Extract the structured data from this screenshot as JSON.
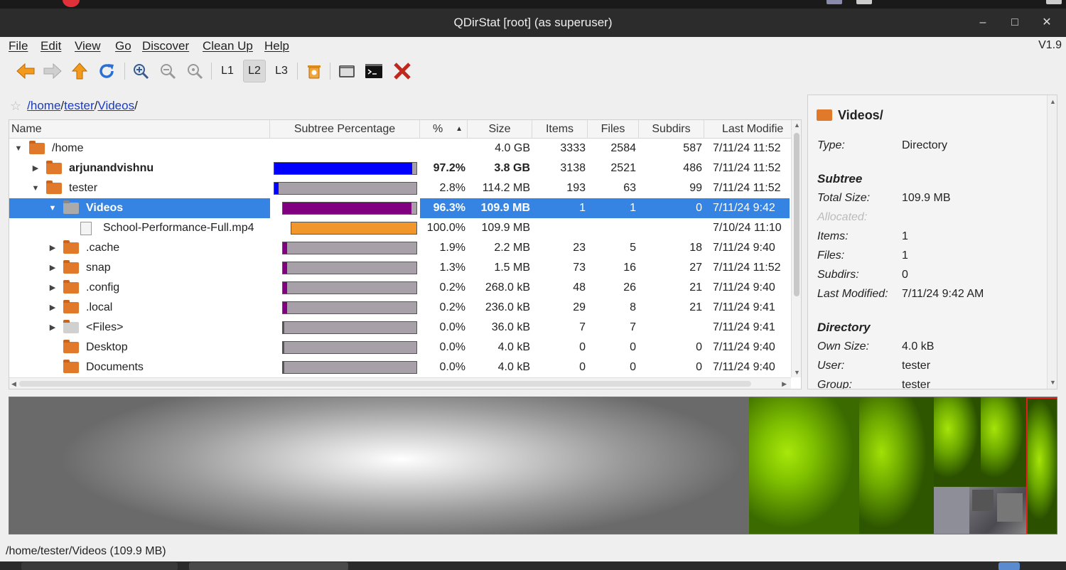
{
  "window": {
    "title": "QDirStat [root] (as superuser)",
    "version": "V1.9"
  },
  "menu": {
    "file": "File",
    "edit": "Edit",
    "view": "View",
    "go": "Go",
    "discover": "Discover",
    "cleanup": "Clean Up",
    "help": "Help"
  },
  "toolbar": {
    "l1": "L1",
    "l2": "L2",
    "l3": "L3"
  },
  "breadcrumb": {
    "sep0": "/",
    "p1": "home",
    "sep1": "/",
    "p2": "tester",
    "sep2": "/",
    "p3": "Videos",
    "sep3": "/"
  },
  "columns": {
    "name": "Name",
    "subtree": "Subtree Percentage",
    "pct": "%",
    "size": "Size",
    "items": "Items",
    "files": "Files",
    "subdirs": "Subdirs",
    "modified": "Last Modifie"
  },
  "rows": [
    {
      "name": "/home",
      "pct": "",
      "fill": 0,
      "fill_color": "",
      "size": "4.0 GB",
      "items": "3333",
      "files": "2584",
      "subdirs": "587",
      "modified": "7/11/24 11:52"
    },
    {
      "name": "arjunandvishnu",
      "pct": "97.2%",
      "fill": 0.972,
      "fill_color": "#0000ff",
      "size": "3.8 GB",
      "items": "3138",
      "files": "2521",
      "subdirs": "486",
      "modified": "7/11/24 11:52"
    },
    {
      "name": "tester",
      "pct": "2.8%",
      "fill": 0.028,
      "fill_color": "#0000ff",
      "size": "114.2 MB",
      "items": "193",
      "files": "63",
      "subdirs": "99",
      "modified": "7/11/24 11:52"
    },
    {
      "name": "Videos",
      "pct": "96.3%",
      "fill": 0.963,
      "fill_color": "#800080",
      "size": "109.9 MB",
      "items": "1",
      "files": "1",
      "subdirs": "0",
      "modified": "7/11/24 9:42 "
    },
    {
      "name": "School-Performance-Full.mp4",
      "pct": "100.0%",
      "fill": 1.0,
      "fill_color": "#f0962a",
      "size": "109.9 MB",
      "items": "",
      "files": "",
      "subdirs": "",
      "modified": "7/10/24 11:10"
    },
    {
      "name": ".cache",
      "pct": "1.9%",
      "fill": 0.019,
      "fill_color": "#800080",
      "size": "2.2 MB",
      "items": "23",
      "files": "5",
      "subdirs": "18",
      "modified": "7/11/24 9:40 "
    },
    {
      "name": "snap",
      "pct": "1.3%",
      "fill": 0.013,
      "fill_color": "#800080",
      "size": "1.5 MB",
      "items": "73",
      "files": "16",
      "subdirs": "27",
      "modified": "7/11/24 11:52"
    },
    {
      "name": ".config",
      "pct": "0.2%",
      "fill": 0.002,
      "fill_color": "#800080",
      "size": "268.0 kB",
      "items": "48",
      "files": "26",
      "subdirs": "21",
      "modified": "7/11/24 9:40 "
    },
    {
      "name": ".local",
      "pct": "0.2%",
      "fill": 0.002,
      "fill_color": "#800080",
      "size": "236.0 kB",
      "items": "29",
      "files": "8",
      "subdirs": "21",
      "modified": "7/11/24 9:41 "
    },
    {
      "name": "<Files>",
      "pct": "0.0%",
      "fill": 0,
      "fill_color": "#800080",
      "size": "36.0 kB",
      "items": "7",
      "files": "7",
      "subdirs": "",
      "modified": "7/11/24 9:41 "
    },
    {
      "name": "Desktop",
      "pct": "0.0%",
      "fill": 0,
      "fill_color": "#800080",
      "size": "4.0 kB",
      "items": "0",
      "files": "0",
      "subdirs": "0",
      "modified": "7/11/24 9:40 "
    },
    {
      "name": "Documents",
      "pct": "0.0%",
      "fill": 0,
      "fill_color": "#800080",
      "size": "4.0 kB",
      "items": "0",
      "files": "0",
      "subdirs": "0",
      "modified": "7/11/24 9:40 "
    }
  ],
  "details": {
    "title": "Videos/",
    "type_label": "Type:",
    "type_value": "Directory",
    "subtree_heading": "Subtree",
    "total_size_label": "Total Size:",
    "total_size_value": "109.9 MB",
    "allocated_label": "Allocated:",
    "items_label": "Items:",
    "items_value": "1",
    "files_label": "Files:",
    "files_value": "1",
    "subdirs_label": "Subdirs:",
    "subdirs_value": "0",
    "modified_label": "Last Modified:",
    "modified_value": "7/11/24 9:42 AM",
    "directory_heading": "Directory",
    "own_size_label": "Own Size:",
    "own_size_value": "4.0 kB",
    "user_label": "User:",
    "user_value": "tester",
    "group_label": "Group:",
    "group_value": "tester"
  },
  "status": {
    "text": "/home/tester/Videos  (109.9 MB)"
  },
  "colors": {
    "selection": "#3584e4",
    "folder": "#e07a2a",
    "treemap_green": "#8fd400"
  }
}
